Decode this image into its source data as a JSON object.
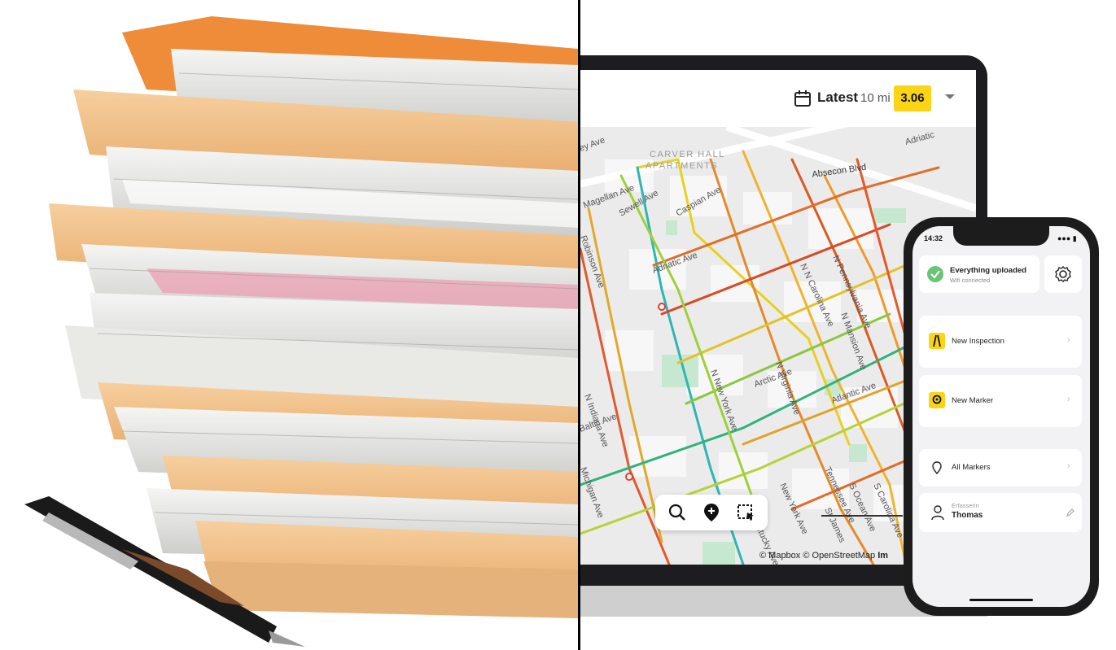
{
  "laptop_app": {
    "date_filter_label": "Latest",
    "distance": "10 mi",
    "score_badge": "3.06",
    "badge_color": "#fbd515",
    "map": {
      "place_labels": [
        "CARVER HALL",
        "APARTMENTS"
      ],
      "street_labels": [
        "Absecon Blvd",
        "Magellan Ave",
        "Sewell Ave",
        "Caspian Ave",
        "Adriatic Ave",
        "N Carolina Ave",
        "N Pennsylvania Ave",
        "N Mansion Ave",
        "N Indiana Ave",
        "N New York Ave",
        "N Virginia Ave",
        "Arctic Ave",
        "Atlantic Ave",
        "Baltic Ave",
        "Robinson Ave",
        "Michigan Ave",
        "Tennessee Ave",
        "S Ocean Ave",
        "New York Ave",
        "S Carolina Ave",
        "St James",
        "Kentucky Ave",
        "Adriatic",
        "ey Ave"
      ],
      "attribution": "© Mapbox © OpenStreetMap",
      "attribution_more": "Im",
      "toolbar_icons": [
        "search-icon",
        "add-marker-icon",
        "area-select-icon"
      ]
    }
  },
  "phone_app": {
    "status_time": "14:32",
    "upload_status": {
      "title": "Everything uploaded",
      "subtitle": "Wifi connected"
    },
    "menu": [
      {
        "label": "New Inspection",
        "icon": "road-icon"
      },
      {
        "label": "New Marker",
        "icon": "marker-icon"
      },
      {
        "label": "All Markers",
        "icon": "pin-outline-icon"
      }
    ],
    "user": {
      "role_label": "Erfasserin",
      "name": "Thomas"
    },
    "chevron": "›"
  }
}
